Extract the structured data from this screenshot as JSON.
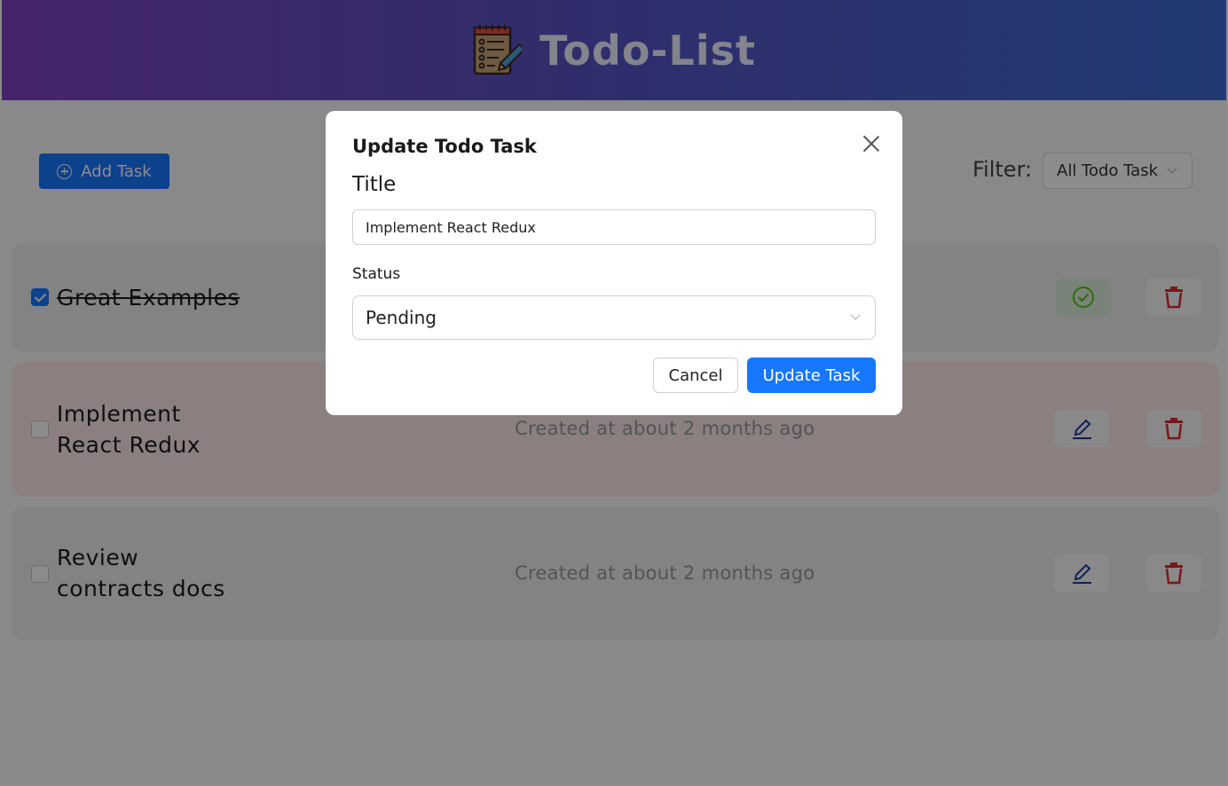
{
  "header": {
    "title": "Todo-List",
    "logo_icon": "notepad-pencil-icon"
  },
  "toolbar": {
    "add_task_label": "Add Task",
    "add_icon": "plus-circle-icon",
    "filter_label": "Filter:",
    "filter_value": "All Todo Task"
  },
  "tasks": [
    {
      "title": "Great Examples",
      "completed": true,
      "created": "",
      "action_icon": "check-circle-icon",
      "delete_icon": "trash-icon"
    },
    {
      "title": "Implement React Redux",
      "completed": false,
      "created": "Created at about 2 months ago",
      "action_icon": "edit-icon",
      "delete_icon": "trash-icon"
    },
    {
      "title": "Review contracts docs",
      "completed": false,
      "created": "Created at about 2 months ago",
      "action_icon": "edit-icon",
      "delete_icon": "trash-icon"
    }
  ],
  "modal": {
    "heading": "Update Todo Task",
    "title_label": "Title",
    "title_value": "Implement React Redux",
    "status_label": "Status",
    "status_value": "Pending",
    "cancel_label": "Cancel",
    "submit_label": "Update Task"
  },
  "colors": {
    "primary": "#1677ff",
    "header_start": "#7e43c3",
    "header_end": "#3d6ad1",
    "pending_row": "#fde8e8",
    "danger": "#e0282e"
  }
}
